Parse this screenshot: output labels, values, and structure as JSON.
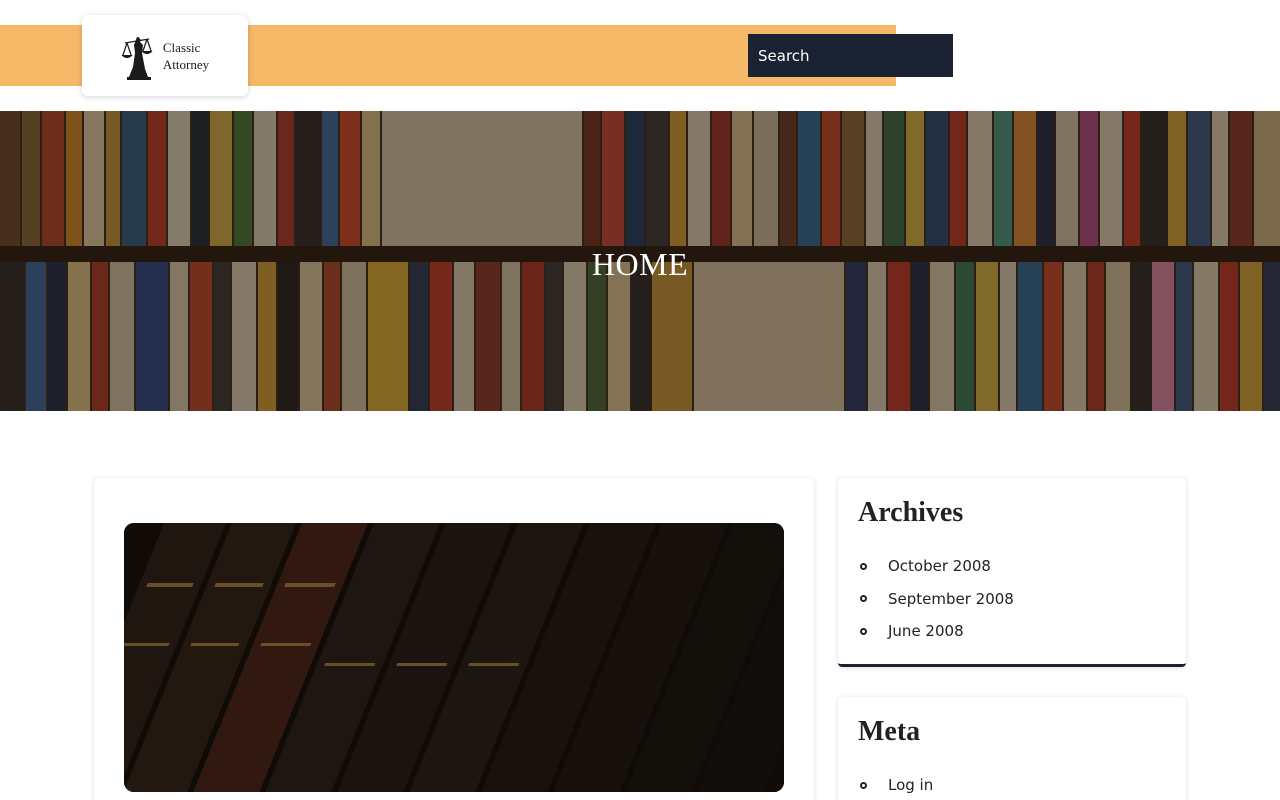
{
  "header": {
    "logo": {
      "line1": "Classic",
      "line2": "Attorney"
    },
    "search": {
      "placeholder": "Search",
      "icon": "search-icon"
    }
  },
  "hero": {
    "title": "HOME"
  },
  "sidebar": {
    "archives": {
      "title": "Archives",
      "items": [
        "October 2008",
        "September 2008",
        "June 2008"
      ]
    },
    "meta": {
      "title": "Meta",
      "items": [
        "Log in"
      ]
    }
  },
  "colors": {
    "header_bar": "#f6b968",
    "search_bg": "#1b2233",
    "accent": "#1b2233"
  }
}
